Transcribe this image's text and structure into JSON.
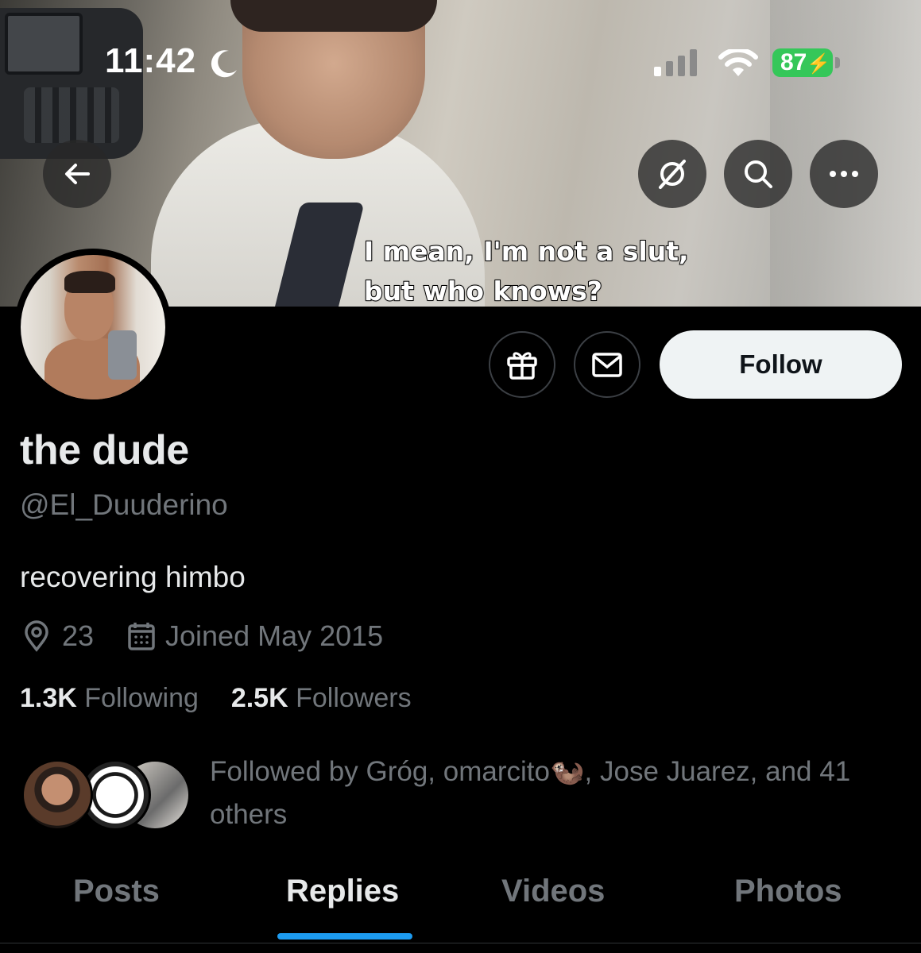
{
  "status_bar": {
    "time": "11:42",
    "battery": "87"
  },
  "banner": {
    "subtitle": "I mean, I'm not a slut,\nbut who knows?"
  },
  "profile": {
    "display_name": "the dude",
    "handle": "@El_Duuderino",
    "bio": "recovering himbo",
    "location": "23",
    "joined": "Joined May 2015",
    "following_count": "1.3K",
    "following_label": "Following",
    "followers_count": "2.5K",
    "followers_label": "Followers",
    "followed_by": "Followed by Gróg, omarcito🦦, Jose Juarez, and 41 others"
  },
  "actions": {
    "follow_label": "Follow"
  },
  "tabs": [
    {
      "label": "Posts"
    },
    {
      "label": "Replies"
    },
    {
      "label": "Videos"
    },
    {
      "label": "Photos"
    }
  ],
  "active_tab": "Replies",
  "colors": {
    "accent": "#1d9bf0",
    "battery": "#35c759",
    "muted": "#71767b"
  },
  "icons": [
    "back-arrow-icon",
    "grok-icon",
    "search-icon",
    "more-icon",
    "gift-icon",
    "mail-icon",
    "location-pin-icon",
    "calendar-icon",
    "moon-icon",
    "signal-icon",
    "wifi-icon"
  ]
}
